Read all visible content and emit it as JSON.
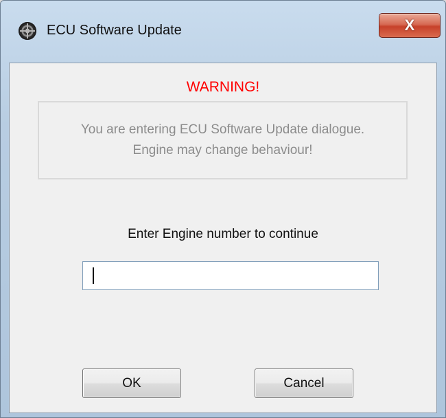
{
  "window": {
    "title": "ECU Software Update",
    "close_label": "X",
    "icon": "gear-icon"
  },
  "dialog": {
    "warning_title": "WARNING!",
    "warning_line1": "You are entering ECU Software Update dialogue.",
    "warning_line2": "Engine may change behaviour!",
    "prompt": "Enter Engine number to continue",
    "engine_number_value": ""
  },
  "buttons": {
    "ok_label": "OK",
    "cancel_label": "Cancel"
  },
  "colors": {
    "warning": "#ff0000",
    "info_text": "#8c8c8c",
    "close_button": "#c7412a"
  }
}
